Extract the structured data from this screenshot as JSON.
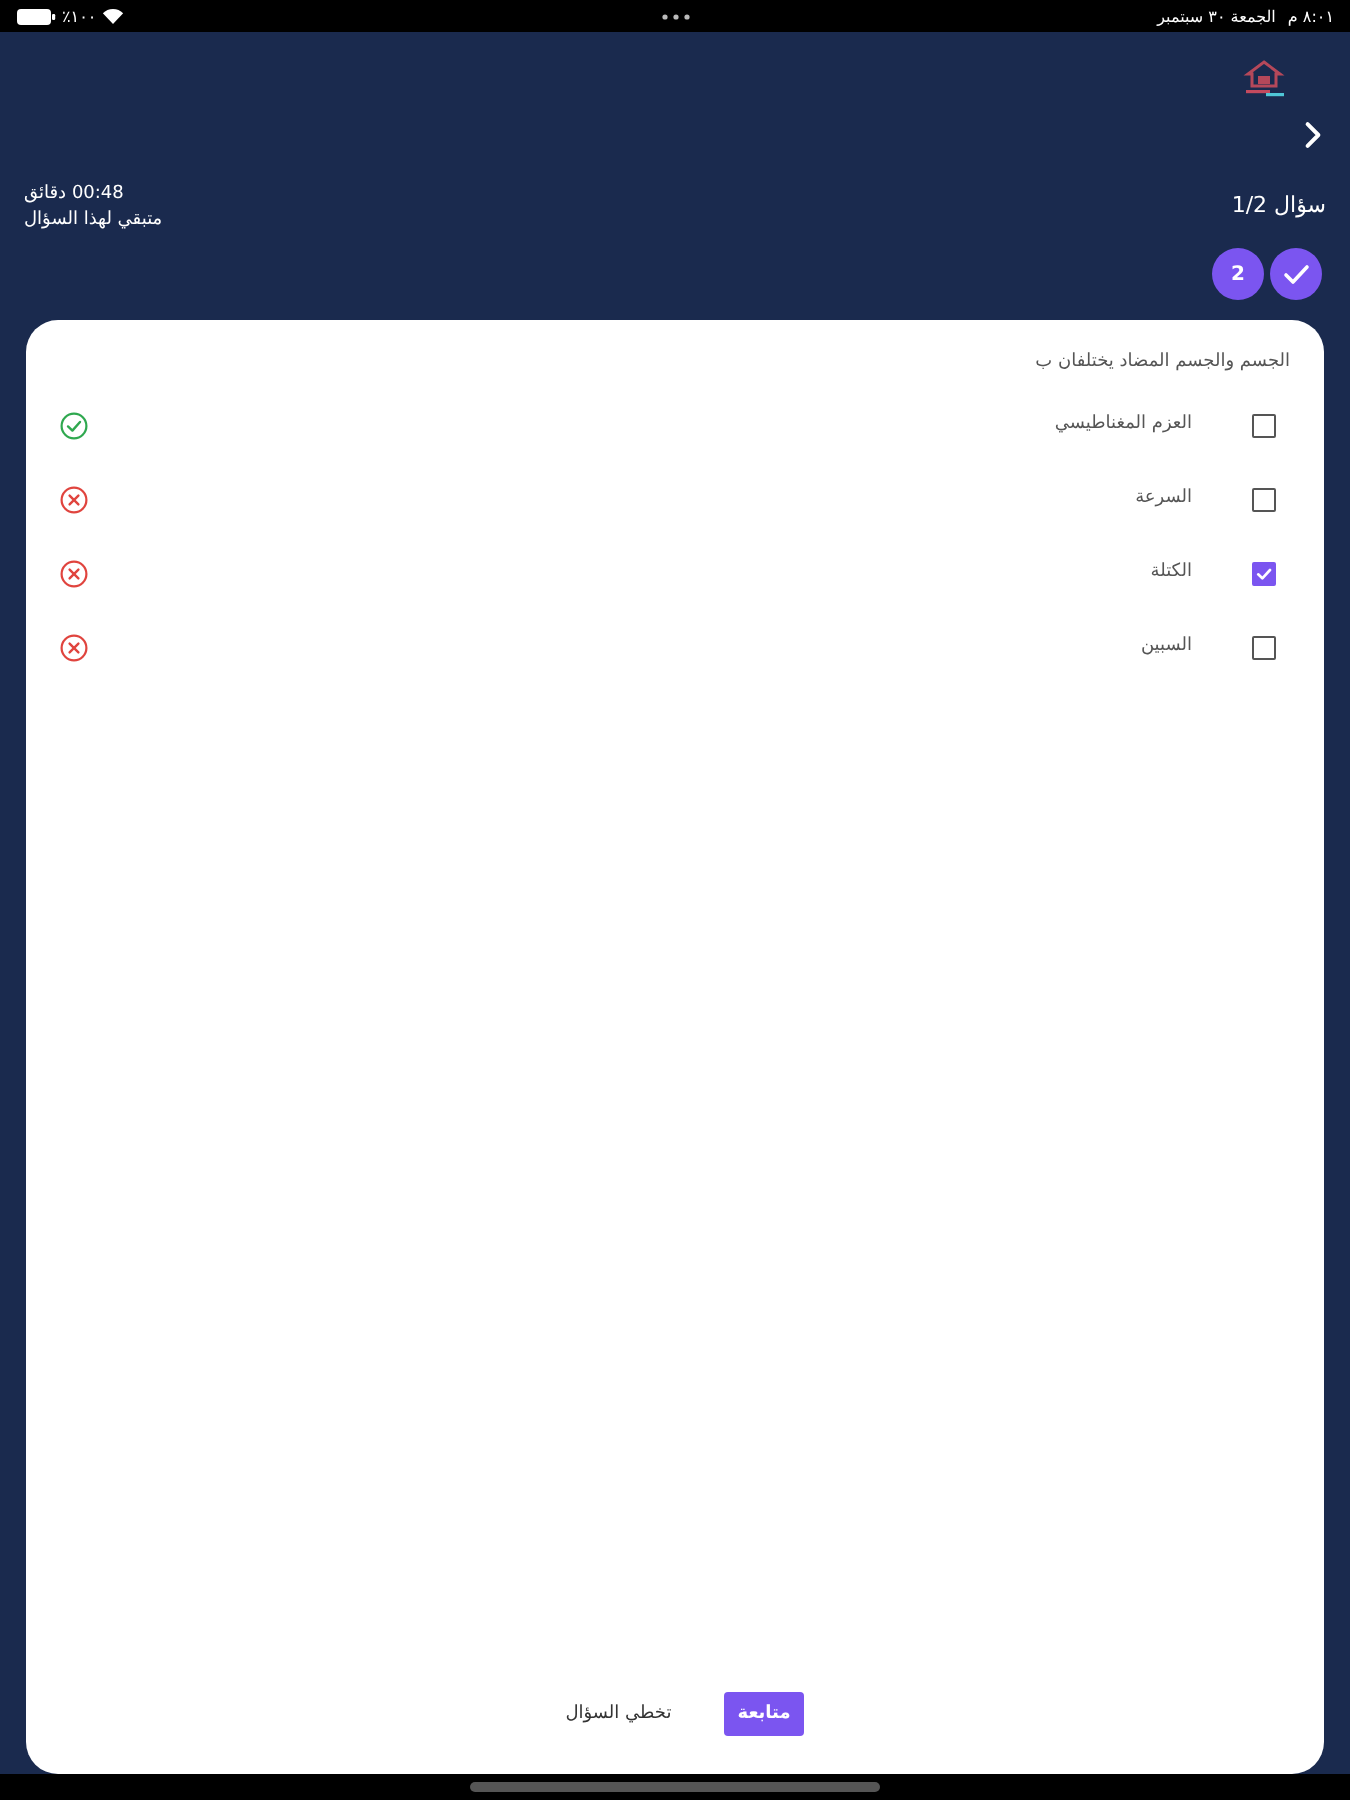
{
  "status_bar": {
    "time": "٨:٠١ م",
    "date": "الجمعة ٣٠ سبتمبر",
    "battery": "١٠٠٪"
  },
  "header": {
    "question_counter": "سؤال 1/2",
    "timer": "00:48 دقائق",
    "timer_label": "متبقي لهذا السؤال"
  },
  "question_steps": [
    {
      "kind": "done"
    },
    {
      "kind": "number",
      "label": "2"
    }
  ],
  "question": {
    "text": "الجسم والجسم المضاد يختلفان ب",
    "options": [
      {
        "label": "العزم المغناطيسي",
        "checked": false,
        "correct": true
      },
      {
        "label": "السرعة",
        "checked": false,
        "correct": false
      },
      {
        "label": "الكتلة",
        "checked": true,
        "correct": false
      },
      {
        "label": "السبين",
        "checked": false,
        "correct": false
      }
    ]
  },
  "buttons": [
    {
      "label": "متابعة",
      "kind": "primary"
    },
    {
      "label": "تخطي السؤال",
      "kind": "text"
    }
  ]
}
